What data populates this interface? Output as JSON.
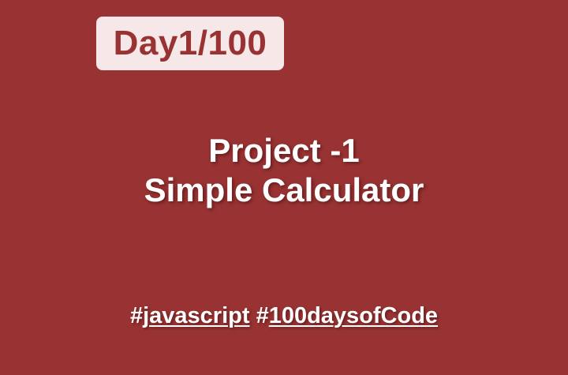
{
  "colors": {
    "background": "#993333",
    "badge_background": "#f6e8e8",
    "badge_text": "#993333",
    "text": "#ffffff"
  },
  "badge": {
    "label": "Day1/100"
  },
  "title": {
    "line1": "Project -1",
    "line2": "Simple Calculator"
  },
  "hashtags": [
    {
      "symbol": "#",
      "text": "javascript"
    },
    {
      "symbol": "#",
      "text": "100daysofCode"
    }
  ]
}
